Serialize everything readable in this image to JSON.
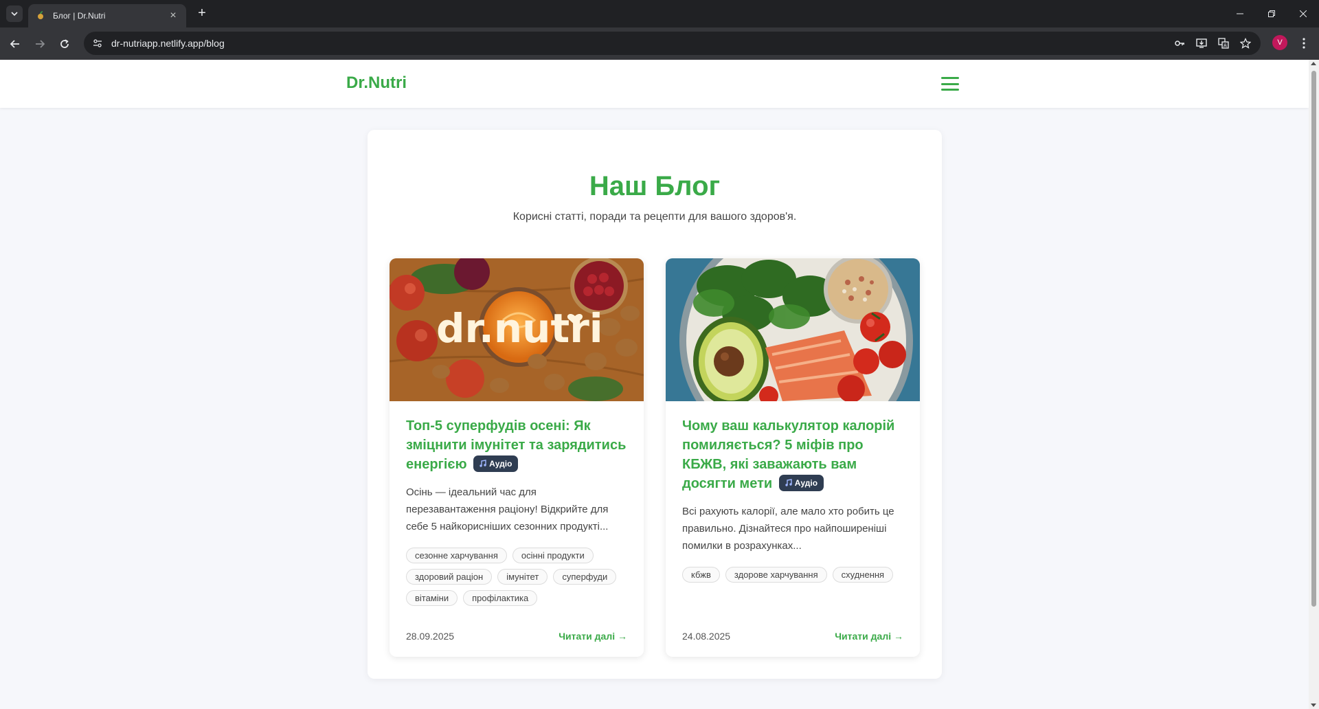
{
  "browser": {
    "tab_title": "Блог | Dr.Nutri",
    "url": "dr-nutriapp.netlify.app/blog",
    "profile_initial": "V"
  },
  "header": {
    "logo": "Dr.Nutri"
  },
  "blog": {
    "title": "Наш Блог",
    "subtitle": "Корисні статті, поради та рецепти для вашого здоров'я."
  },
  "posts": [
    {
      "image_text": "dr.nutri",
      "title": "Топ-5 суперфудів осені: Як зміцнити імунітет та зарядитись енергією",
      "audio_label": "Аудіо",
      "excerpt": "Осінь — ідеальний час для перезавантаження раціону! Відкрийте для себе 5 найкорисніших сезонних продукті...",
      "tags": [
        "сезонне харчування",
        "осінні продукти",
        "здоровий раціон",
        "імунітет",
        "суперфуди",
        "вітаміни",
        "профілактика"
      ],
      "date": "28.09.2025",
      "read_more": "Читати далі →"
    },
    {
      "title": "Чому ваш калькулятор калорій помиляється? 5 міфів про КБЖВ, які заважають вам досягти мети",
      "audio_label": "Аудіо",
      "excerpt": "Всі рахують калорії, але мало хто робить це правильно. Дізнайтеся про найпоширеніші помилки в розрахунках...",
      "tags": [
        "кбжв",
        "здорове харчування",
        "схуднення"
      ],
      "date": "24.08.2025",
      "read_more": "Читати далі →"
    }
  ],
  "colors": {
    "brand_green": "#3aaa48",
    "badge_bg": "#2f3d52",
    "page_bg": "#f6f7fb"
  }
}
